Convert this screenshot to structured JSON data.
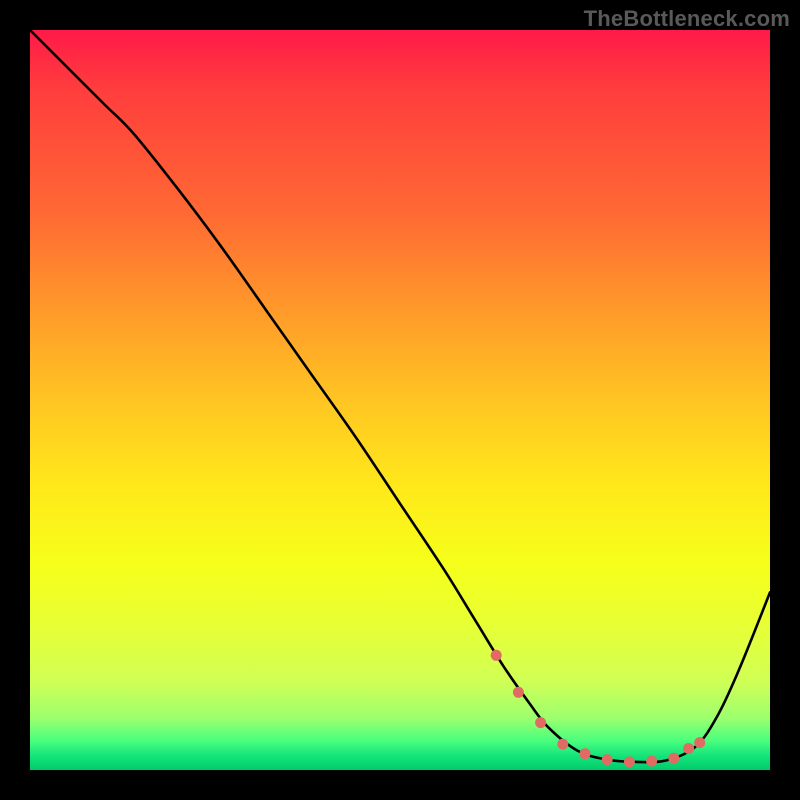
{
  "watermark": "TheBottleneck.com",
  "chart_data": {
    "type": "line",
    "title": "",
    "xlabel": "",
    "ylabel": "",
    "xlim": [
      0,
      100
    ],
    "ylim": [
      0,
      100
    ],
    "series": [
      {
        "name": "bottleneck-curve",
        "x": [
          0,
          6,
          10,
          14,
          20,
          26,
          32,
          38,
          44,
          50,
          56,
          60,
          64,
          67.5,
          70,
          74,
          78,
          82,
          86,
          90,
          93,
          96,
          100
        ],
        "y": [
          100,
          94,
          90,
          86,
          78.5,
          70.5,
          62,
          53.5,
          45,
          36,
          27,
          20.5,
          14,
          9,
          5.8,
          2.6,
          1.4,
          1.1,
          1.3,
          3.2,
          7.5,
          14,
          24
        ],
        "color": "#000000"
      }
    ],
    "markers": {
      "name": "highlight-points",
      "x": [
        63,
        66,
        69,
        72,
        75,
        78,
        81,
        84,
        87,
        89,
        90.5
      ],
      "y": [
        15.5,
        10.5,
        6.4,
        3.5,
        2.2,
        1.4,
        1.1,
        1.2,
        1.6,
        2.9,
        3.7
      ],
      "color": "#e16a63"
    },
    "gradient_colors": {
      "top": "#ff1a48",
      "mid": "#ffe91a",
      "bottom": "#00cc6b"
    }
  }
}
